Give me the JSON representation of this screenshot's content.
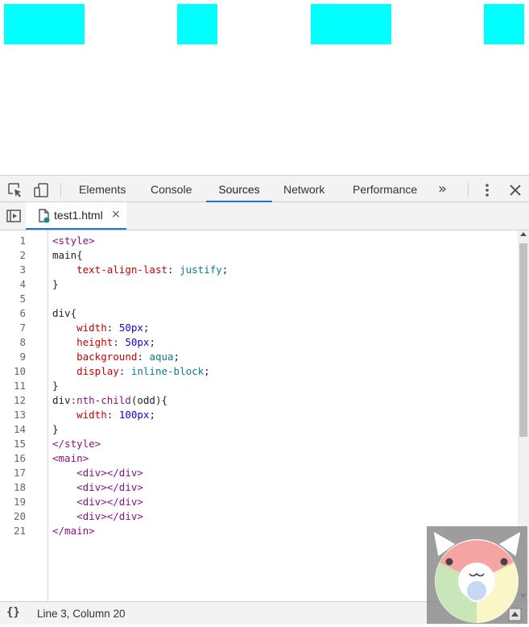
{
  "devtools": {
    "tabs": [
      {
        "label": "Elements",
        "active": false
      },
      {
        "label": "Console",
        "active": false
      },
      {
        "label": "Sources",
        "active": true
      },
      {
        "label": "Network",
        "active": false
      },
      {
        "label": "Performance",
        "active": false
      }
    ],
    "more_tabs_glyph": "»",
    "accent_color": "#1a73e8"
  },
  "file_tab": {
    "name": "test1.html",
    "close_glyph": "×"
  },
  "preview": {
    "box_color": "#00ffff"
  },
  "editor": {
    "line_numbers": [
      "1",
      "2",
      "3",
      "4",
      "5",
      "6",
      "7",
      "8",
      "9",
      "10",
      "11",
      "12",
      "13",
      "14",
      "15",
      "16",
      "17",
      "18",
      "19",
      "20",
      "21"
    ],
    "lines": [
      [
        {
          "t": "<style>",
          "c": "tag"
        }
      ],
      [
        {
          "t": "main{",
          "c": ""
        }
      ],
      [
        {
          "t": "    ",
          "c": ""
        },
        {
          "t": "text-align-last",
          "c": "prop"
        },
        {
          "t": ": ",
          "c": ""
        },
        {
          "t": "justify",
          "c": "kw"
        },
        {
          "t": ";",
          "c": ""
        }
      ],
      [
        {
          "t": "}",
          "c": ""
        }
      ],
      [
        {
          "t": "",
          "c": ""
        }
      ],
      [
        {
          "t": "div{",
          "c": ""
        }
      ],
      [
        {
          "t": "    ",
          "c": ""
        },
        {
          "t": "width",
          "c": "prop"
        },
        {
          "t": ": ",
          "c": ""
        },
        {
          "t": "50px",
          "c": "num"
        },
        {
          "t": ";",
          "c": ""
        }
      ],
      [
        {
          "t": "    ",
          "c": ""
        },
        {
          "t": "height",
          "c": "prop"
        },
        {
          "t": ": ",
          "c": ""
        },
        {
          "t": "50px",
          "c": "num"
        },
        {
          "t": ";",
          "c": ""
        }
      ],
      [
        {
          "t": "    ",
          "c": ""
        },
        {
          "t": "background",
          "c": "prop"
        },
        {
          "t": ": ",
          "c": ""
        },
        {
          "t": "aqua",
          "c": "kw"
        },
        {
          "t": ";",
          "c": ""
        }
      ],
      [
        {
          "t": "    ",
          "c": ""
        },
        {
          "t": "display",
          "c": "prop"
        },
        {
          "t": ": ",
          "c": ""
        },
        {
          "t": "inline-block",
          "c": "kw"
        },
        {
          "t": ";",
          "c": ""
        }
      ],
      [
        {
          "t": "}",
          "c": ""
        }
      ],
      [
        {
          "t": "div",
          "c": ""
        },
        {
          "t": ":nth-child",
          "c": "tag"
        },
        {
          "t": "(odd){",
          "c": ""
        }
      ],
      [
        {
          "t": "    ",
          "c": ""
        },
        {
          "t": "width",
          "c": "prop"
        },
        {
          "t": ": ",
          "c": ""
        },
        {
          "t": "100px",
          "c": "num"
        },
        {
          "t": ";",
          "c": ""
        }
      ],
      [
        {
          "t": "}",
          "c": ""
        }
      ],
      [
        {
          "t": "</style>",
          "c": "tag"
        }
      ],
      [
        {
          "t": "<main>",
          "c": "tag"
        }
      ],
      [
        {
          "t": "    ",
          "c": ""
        },
        {
          "t": "<div></div>",
          "c": "tag"
        }
      ],
      [
        {
          "t": "    ",
          "c": ""
        },
        {
          "t": "<div></div>",
          "c": "tag"
        }
      ],
      [
        {
          "t": "    ",
          "c": ""
        },
        {
          "t": "<div></div>",
          "c": "tag"
        }
      ],
      [
        {
          "t": "    ",
          "c": ""
        },
        {
          "t": "<div></div>",
          "c": "tag"
        }
      ],
      [
        {
          "t": "</main>",
          "c": "tag"
        }
      ]
    ]
  },
  "status_bar": {
    "format_glyph": "{}",
    "cursor_position": "Line 3, Column 20"
  }
}
